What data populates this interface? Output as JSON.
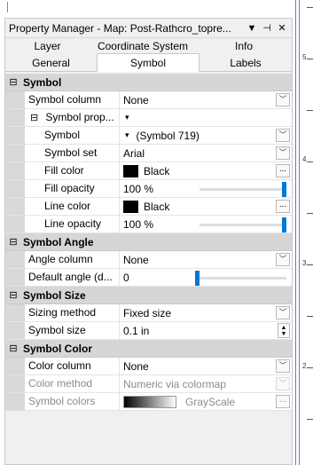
{
  "window": {
    "title": "Property Manager - Map: Post-Rathcro_topre...",
    "dropdown_glyph": "▼",
    "pin_glyph": "⊣",
    "close_glyph": "✕"
  },
  "tabs": {
    "row1": [
      "Layer",
      "Coordinate System",
      "Info"
    ],
    "row2": [
      "General",
      "Symbol",
      "Labels"
    ],
    "active": "Symbol"
  },
  "sections": {
    "symbol": "Symbol",
    "symbol_angle": "Symbol Angle",
    "symbol_size": "Symbol Size",
    "symbol_color": "Symbol Color"
  },
  "toggle_glyph": "⊟",
  "symbol": {
    "symbol_column_label": "Symbol column",
    "symbol_column_value": "None",
    "symbol_prop_label": "Symbol prop...",
    "symbol_label": "Symbol",
    "symbol_value": "(Symbol 719)",
    "symbol_set_label": "Symbol set",
    "symbol_set_value": "Arial",
    "fill_color_label": "Fill color",
    "fill_color_value": "Black",
    "fill_opacity_label": "Fill opacity",
    "fill_opacity_value": "100 %",
    "line_color_label": "Line color",
    "line_color_value": "Black",
    "line_opacity_label": "Line opacity",
    "line_opacity_value": "100 %"
  },
  "symbol_angle": {
    "angle_column_label": "Angle column",
    "angle_column_value": "None",
    "default_angle_label": "Default angle (d...",
    "default_angle_value": "0"
  },
  "symbol_size": {
    "sizing_method_label": "Sizing method",
    "sizing_method_value": "Fixed size",
    "symbol_size_label": "Symbol size",
    "symbol_size_value": "0.1 in"
  },
  "symbol_color": {
    "color_column_label": "Color column",
    "color_column_value": "None",
    "color_method_label": "Color method",
    "color_method_value": "Numeric via colormap",
    "symbol_colors_label": "Symbol colors",
    "symbol_colors_value": "GrayScale"
  },
  "ruler": {
    "labels": [
      "5",
      "4",
      "3",
      "2"
    ]
  },
  "colors": {
    "accent": "#0078d7",
    "section_bg": "#d6d6d6",
    "gutter_bg": "#d9d9d9",
    "swatch": "#000000"
  }
}
